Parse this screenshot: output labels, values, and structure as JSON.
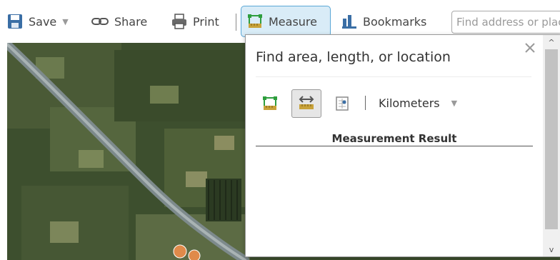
{
  "toolbar": {
    "save_label": "Save",
    "share_label": "Share",
    "print_label": "Print",
    "measure_label": "Measure",
    "bookmarks_label": "Bookmarks",
    "search_placeholder": "Find address or place",
    "caret": "▼"
  },
  "measure_panel": {
    "title": "Find area, length, or location",
    "close_symbol": "✕",
    "unit": "Kilometers",
    "unit_caret": "▼",
    "unit_separator": "|",
    "result_title": "Measurement Result",
    "active_tool": "distance",
    "tools": [
      "area-icon",
      "distance-icon",
      "location-icon"
    ]
  },
  "scrollbar": {
    "up_arrow": "^",
    "down_arrow": "v"
  },
  "colors": {
    "active_tool_border": "#5aa7d6",
    "active_tool_fill": "#d9ecf7",
    "icon_green": "#2e9e3e",
    "icon_gold": "#c8a23a",
    "icon_blue": "#3a6ea5",
    "map_base": "#3d4f2e",
    "river": "#7d8a8c"
  },
  "icons": {
    "save": "floppy-disk-icon",
    "share": "chain-link-icon",
    "print": "printer-icon",
    "measure": "measure-icon",
    "bookmarks": "bookmark-icon",
    "close": "close-icon"
  }
}
